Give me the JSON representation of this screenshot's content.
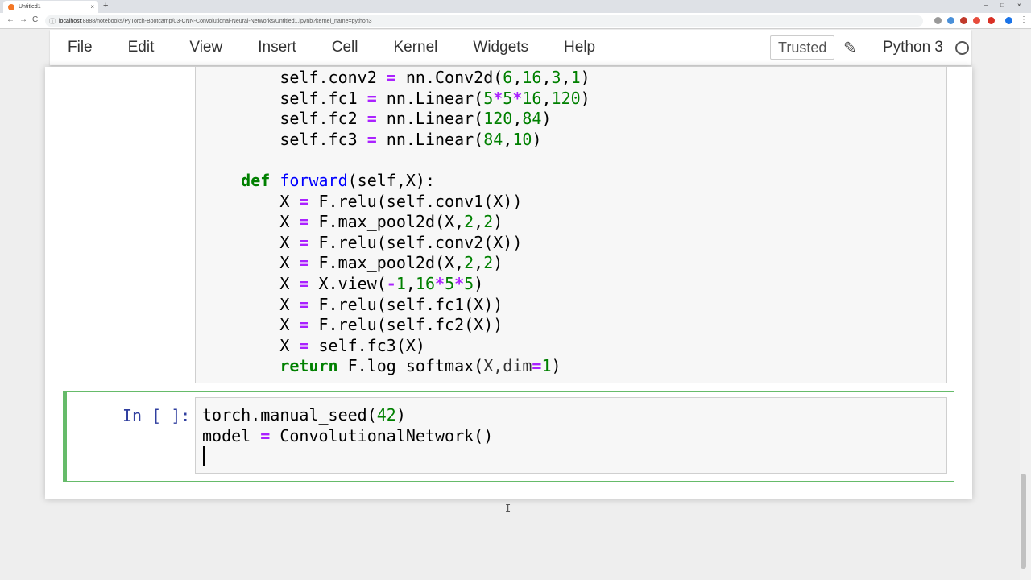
{
  "browser": {
    "tab_title": "Untitled1",
    "tab_close": "×",
    "new_tab": "+",
    "url_host": "localhost",
    "url_rest": ":8888/notebooks/PyTorch-Bootcamp/03-CNN-Convolutional-Neural-Networks/Untitled1.ipynb?kernel_name=python3",
    "back": "←",
    "forward": "→",
    "reload": "C",
    "minimize": "–",
    "maximize": "□",
    "close": "×"
  },
  "menubar": {
    "items": [
      "File",
      "Edit",
      "View",
      "Insert",
      "Cell",
      "Kernel",
      "Widgets",
      "Help"
    ],
    "trusted_label": "Trusted",
    "kernel_name": "Python 3"
  },
  "cell1": {
    "lines": [
      [
        {
          "t": "        self.conv2 "
        },
        {
          "t": "=",
          "c": "op"
        },
        {
          "t": " nn.Conv2d("
        },
        {
          "t": "6",
          "c": "num"
        },
        {
          "t": ","
        },
        {
          "t": "16",
          "c": "num"
        },
        {
          "t": ","
        },
        {
          "t": "3",
          "c": "num"
        },
        {
          "t": ","
        },
        {
          "t": "1",
          "c": "num"
        },
        {
          "t": ")"
        }
      ],
      [
        {
          "t": "        self.fc1 "
        },
        {
          "t": "=",
          "c": "op"
        },
        {
          "t": " nn.Linear("
        },
        {
          "t": "5",
          "c": "num"
        },
        {
          "t": "*",
          "c": "op"
        },
        {
          "t": "5",
          "c": "num"
        },
        {
          "t": "*",
          "c": "op"
        },
        {
          "t": "16",
          "c": "num"
        },
        {
          "t": ","
        },
        {
          "t": "120",
          "c": "num"
        },
        {
          "t": ")"
        }
      ],
      [
        {
          "t": "        self.fc2 "
        },
        {
          "t": "=",
          "c": "op"
        },
        {
          "t": " nn.Linear("
        },
        {
          "t": "120",
          "c": "num"
        },
        {
          "t": ","
        },
        {
          "t": "84",
          "c": "num"
        },
        {
          "t": ")"
        }
      ],
      [
        {
          "t": "        self.fc3 "
        },
        {
          "t": "=",
          "c": "op"
        },
        {
          "t": " nn.Linear("
        },
        {
          "t": "84",
          "c": "num"
        },
        {
          "t": ","
        },
        {
          "t": "10",
          "c": "num"
        },
        {
          "t": ")"
        }
      ],
      [
        {
          "t": ""
        }
      ],
      [
        {
          "t": "    "
        },
        {
          "t": "def",
          "c": "kw"
        },
        {
          "t": " "
        },
        {
          "t": "forward",
          "c": "fn"
        },
        {
          "t": "(self,X):"
        }
      ],
      [
        {
          "t": "        X "
        },
        {
          "t": "=",
          "c": "op"
        },
        {
          "t": " F.relu(self.conv1(X))"
        }
      ],
      [
        {
          "t": "        X "
        },
        {
          "t": "=",
          "c": "op"
        },
        {
          "t": " F.max_pool2d(X,"
        },
        {
          "t": "2",
          "c": "num"
        },
        {
          "t": ","
        },
        {
          "t": "2",
          "c": "num"
        },
        {
          "t": ")"
        }
      ],
      [
        {
          "t": "        X "
        },
        {
          "t": "=",
          "c": "op"
        },
        {
          "t": " F.relu(self.conv2(X))"
        }
      ],
      [
        {
          "t": "        X "
        },
        {
          "t": "=",
          "c": "op"
        },
        {
          "t": " F.max_pool2d(X,"
        },
        {
          "t": "2",
          "c": "num"
        },
        {
          "t": ","
        },
        {
          "t": "2",
          "c": "num"
        },
        {
          "t": ")"
        }
      ],
      [
        {
          "t": "        X "
        },
        {
          "t": "=",
          "c": "op"
        },
        {
          "t": " X.view("
        },
        {
          "t": "-",
          "c": "op"
        },
        {
          "t": "1",
          "c": "num"
        },
        {
          "t": ","
        },
        {
          "t": "16",
          "c": "num"
        },
        {
          "t": "*",
          "c": "op"
        },
        {
          "t": "5",
          "c": "num"
        },
        {
          "t": "*",
          "c": "op"
        },
        {
          "t": "5",
          "c": "num"
        },
        {
          "t": ")"
        }
      ],
      [
        {
          "t": "        X "
        },
        {
          "t": "=",
          "c": "op"
        },
        {
          "t": " F.relu(self.fc1(X))"
        }
      ],
      [
        {
          "t": "        X "
        },
        {
          "t": "=",
          "c": "op"
        },
        {
          "t": " F.relu(self.fc2(X))"
        }
      ],
      [
        {
          "t": "        X "
        },
        {
          "t": "=",
          "c": "op"
        },
        {
          "t": " self.fc3(X)"
        }
      ],
      [
        {
          "t": "        "
        },
        {
          "t": "return",
          "c": "kw"
        },
        {
          "t": " F.log_softmax("
        },
        {
          "t": "X,dim",
          "c": "br"
        },
        {
          "t": "=",
          "c": "op"
        },
        {
          "t": "1",
          "c": "num"
        },
        {
          "t": ")"
        }
      ]
    ]
  },
  "cell2": {
    "prompt": "In [ ]:",
    "lines": [
      [
        {
          "t": "torch.manual_seed("
        },
        {
          "t": "42",
          "c": "num"
        },
        {
          "t": ")"
        }
      ],
      [
        {
          "t": "model "
        },
        {
          "t": "=",
          "c": "op"
        },
        {
          "t": " ConvolutionalNetwork()"
        }
      ]
    ]
  },
  "pointer": "I",
  "colors": {
    "keyword": "#008000",
    "number": "#008000",
    "operator": "#aa22ff",
    "function_name": "#0000ff",
    "prompt": "#303f9f",
    "selected_cell_border": "#66bb6a"
  }
}
